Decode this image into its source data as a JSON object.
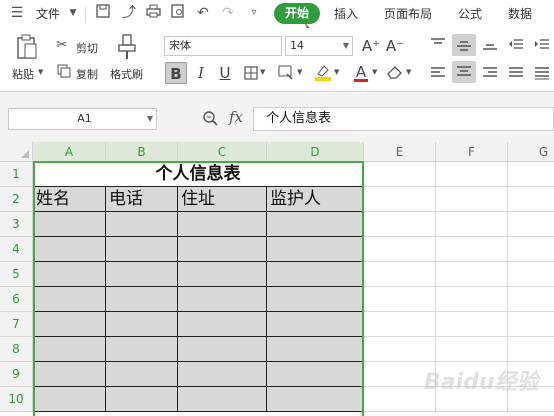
{
  "menubar": {
    "file_label": "文件",
    "tabs": [
      "开始",
      "插入",
      "页面布局",
      "公式",
      "数据"
    ]
  },
  "ribbon": {
    "paste_label": "粘贴",
    "cut_label": "剪切",
    "copy_label": "复制",
    "format_painter_label": "格式刷",
    "font_name": "宋体",
    "font_size": "14",
    "bold": "B",
    "italic": "I",
    "underline": "U",
    "font_color_glyph": "A",
    "grow_font": "A⁺",
    "shrink_font": "A⁻"
  },
  "formula_bar": {
    "name_box": "A1",
    "fx_label": "fx",
    "formula_value": "个人信息表"
  },
  "sheet": {
    "columns": [
      "A",
      "B",
      "C",
      "D",
      "E",
      "F",
      "G"
    ],
    "rows": [
      "1",
      "2",
      "3",
      "4",
      "5",
      "6",
      "7",
      "8",
      "9",
      "10"
    ],
    "title": "个人信息表",
    "headers": [
      "姓名",
      "电话",
      "住址",
      "监护人"
    ]
  },
  "colors": {
    "accent": "#2e9e3b",
    "selection_border": "#4aa84a",
    "data_fill": "#d8d8d8"
  },
  "watermark": "Baidu经验"
}
